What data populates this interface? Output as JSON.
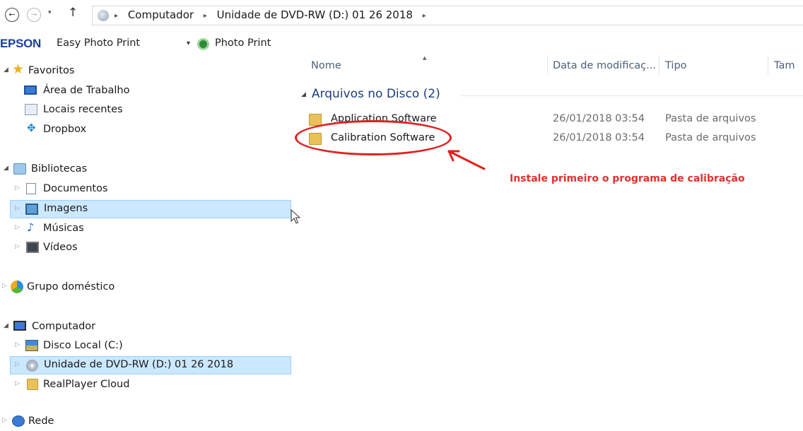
{
  "addressbar": {
    "back_glyph": "←",
    "forward_glyph": "→",
    "dropdown_glyph": "▾",
    "up_glyph": "↑",
    "separator": "▸",
    "crumbs": [
      "Computador",
      "Unidade de DVD-RW (D:) 01 26 2018"
    ]
  },
  "toolbar": {
    "brand": "EPSON",
    "easy_photo_print": "Easy Photo Print",
    "caret": "▾",
    "photo_print": "Photo Print"
  },
  "sidebar": {
    "favorites": {
      "label": "Favoritos",
      "icon": "star-icon",
      "items": [
        {
          "label": "Área de Trabalho",
          "icon": "desktop-icon"
        },
        {
          "label": "Locais recentes",
          "icon": "recent-places-icon"
        },
        {
          "label": "Dropbox",
          "icon": "dropbox-icon"
        }
      ]
    },
    "libraries": {
      "label": "Bibliotecas",
      "icon": "library-icon",
      "items": [
        {
          "label": "Documentos",
          "icon": "documents-icon"
        },
        {
          "label": "Imagens",
          "icon": "pictures-icon",
          "hovered": true
        },
        {
          "label": "Músicas",
          "icon": "music-icon"
        },
        {
          "label": "Vídeos",
          "icon": "videos-icon"
        }
      ]
    },
    "homegroup": {
      "label": "Grupo doméstico",
      "icon": "homegroup-icon"
    },
    "computer": {
      "label": "Computador",
      "icon": "computer-icon",
      "items": [
        {
          "label": "Disco Local (C:)",
          "icon": "local-disk-icon"
        },
        {
          "label": "Unidade de DVD-RW (D:) 01 26 2018",
          "icon": "dvd-drive-icon",
          "selected": true
        },
        {
          "label": "RealPlayer Cloud",
          "icon": "folder-icon"
        }
      ]
    },
    "network_partial_label": "Rede"
  },
  "content": {
    "columns": [
      "Nome",
      "Data de modificaç...",
      "Tipo",
      "Tam"
    ],
    "group": {
      "label": "Arquivos no Disco (2)"
    },
    "files": [
      {
        "name": "Application Software",
        "date": "26/01/2018 03:54",
        "type": "Pasta de arquivos"
      },
      {
        "name": "Calibration Software",
        "date": "26/01/2018 03:54",
        "type": "Pasta de arquivos"
      }
    ],
    "annotation": "Instale primeiro o programa de calibração"
  },
  "colors": {
    "annotation_red": "#e02020",
    "selection_bg": "#cce8ff",
    "selection_border": "#99d1ff",
    "epson_blue": "#1b3f9a"
  }
}
